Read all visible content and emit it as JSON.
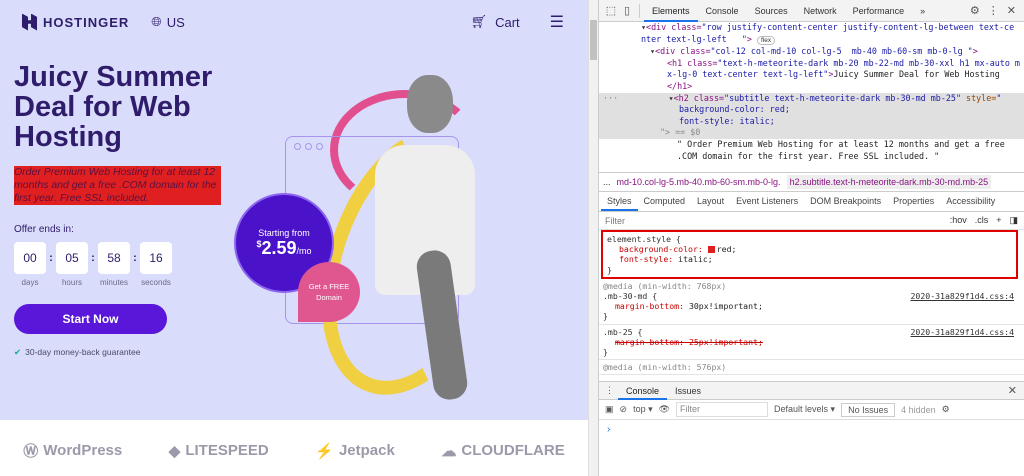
{
  "site": {
    "logo": "HOSTINGER",
    "lang": "US",
    "cart": "Cart",
    "title": "Juicy Summer Deal for Web Hosting",
    "subtitle": "Order Premium Web Hosting for at least 12 months and get a free .COM domain for the first year. Free SSL included.",
    "offer_label": "Offer ends in:",
    "timer": [
      {
        "v": "00",
        "l": "days"
      },
      {
        "v": "05",
        "l": "hours"
      },
      {
        "v": "58",
        "l": "minutes"
      },
      {
        "v": "16",
        "l": "seconds"
      }
    ],
    "start_button": "Start Now",
    "guarantee": "30-day money-back guarantee",
    "price": {
      "label": "Starting from",
      "currency": "$",
      "amount": "2.59",
      "unit": "/mo"
    },
    "free_domain": "Get a FREE Domain",
    "brands": [
      "WordPress",
      "LITESPEED",
      "Jetpack",
      "CLOUDFLARE"
    ]
  },
  "devtools": {
    "tabs": [
      "Elements",
      "Console",
      "Sources",
      "Network",
      "Performance"
    ],
    "more": "»",
    "code": {
      "l1a": "<div class=",
      "l1b": "\"row justify-content-center justify-content-lg-between text-ce",
      "l1c": "nter text-lg-left   \"",
      "flex": "flex",
      "l2a": "<div class=",
      "l2b": "\"col-12 col-md-10 col-lg-5  mb-40 mb-60-sm mb-0-lg \"",
      "l3a": "<h1 class=",
      "l3b": "\"text-h-meteorite-dark mb-20 mb-22-md mb-30-xxl h1 mx-auto m",
      "l3c": "x-lg-0 text-center text-lg-left\"",
      "l3d": "Juicy Summer Deal for Web Hosting",
      "l3e": "</h1>",
      "l4a": "<h2 class=",
      "l4b": "\"subtitle text-h-meteorite-dark mb-30-md mb-25\"",
      "l4c": " style=",
      "l4d": "background-color: red;",
      "l4e": "font-style: italic;",
      "l4f": "\"> == $0",
      "l5a": "\" Order Premium Web Hosting for at least 12 months and get a free",
      "l5b": ".COM domain for the first year. Free SSL included. \""
    },
    "crumbs": [
      "...",
      "md-10.col-lg-5.mb-40.mb-60-sm.mb-0-lg.",
      "h2.subtitle.text-h-meteorite-dark.mb-30-md.mb-25",
      "..."
    ],
    "subtabs": [
      "Styles",
      "Computed",
      "Layout",
      "Event Listeners",
      "DOM Breakpoints",
      "Properties",
      "Accessibility"
    ],
    "filter": "Filter",
    "hov": ":hov",
    "cls": ".cls",
    "plus": "+",
    "rules": {
      "r1sel": "element.style {",
      "r1p1": "background-color:",
      "r1v1": "red;",
      "r1p2": "font-style:",
      "r1v2": "italic;",
      "close": "}",
      "r2media": "@media (min-width: 768px)",
      "r2sel": ".mb-30-md {",
      "r2p": "margin-bottom:",
      "r2v": "30px!important;",
      "r2src": "2020-31a829f1d4.css:4",
      "r3sel": ".mb-25 {",
      "r3p": "margin-bottom: 25px!important;",
      "r3src": "2020-31a829f1d4.css:4",
      "r4media": "@media (min-width: 576px)"
    },
    "drawer": {
      "tabs": [
        "Console",
        "Issues"
      ],
      "context": "top ▾",
      "filter": "Filter",
      "levels": "Default levels ▾",
      "issues": "No Issues",
      "hidden": "4 hidden",
      "prompt": "›"
    }
  }
}
